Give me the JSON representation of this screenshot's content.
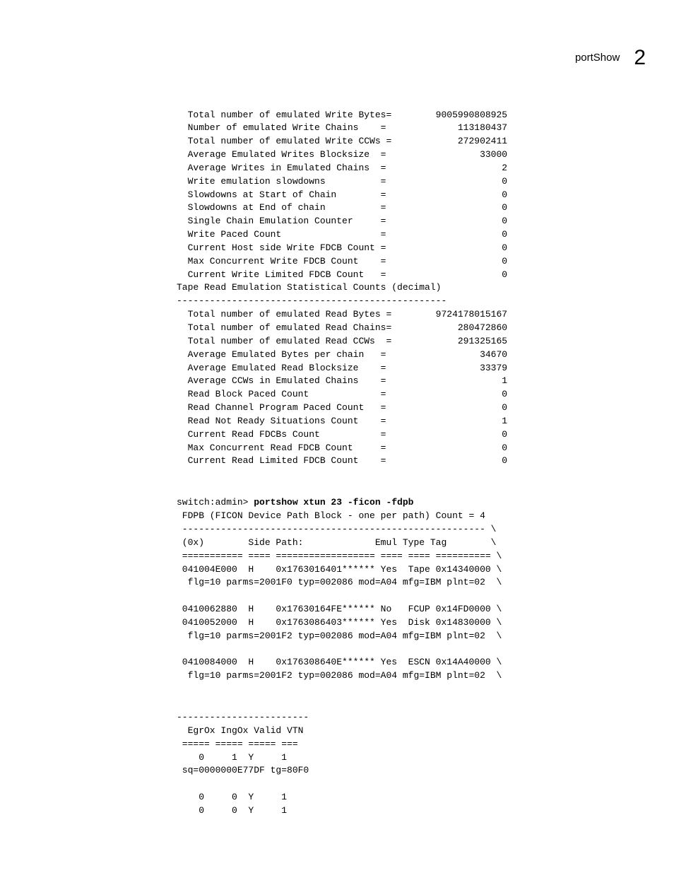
{
  "header": {
    "title": "portShow",
    "chapter": "2"
  },
  "write_stats": [
    {
      "label": "Total number of emulated Write Bytes=",
      "value": "9005990808925"
    },
    {
      "label": "Number of emulated Write Chains    =",
      "value": "113180437"
    },
    {
      "label": "Total number of emulated Write CCWs =",
      "value": "272902411"
    },
    {
      "label": "Average Emulated Writes Blocksize  =",
      "value": "33000"
    },
    {
      "label": "Average Writes in Emulated Chains  =",
      "value": "2"
    },
    {
      "label": "Write emulation slowdowns          =",
      "value": "0"
    },
    {
      "label": "Slowdowns at Start of Chain        =",
      "value": "0"
    },
    {
      "label": "Slowdowns at End of chain          =",
      "value": "0"
    },
    {
      "label": "Single Chain Emulation Counter     =",
      "value": "0"
    },
    {
      "label": "Write Paced Count                  =",
      "value": "0"
    },
    {
      "label": "Current Host side Write FDCB Count =",
      "value": "0"
    },
    {
      "label": "Max Concurrent Write FDCB Count    =",
      "value": "0"
    },
    {
      "label": "Current Write Limited FDCB Count   =",
      "value": "0"
    }
  ],
  "read_section_title": "Tape Read Emulation Statistical Counts (decimal)",
  "read_sep": "-------------------------------------------------",
  "read_stats": [
    {
      "label": "Total number of emulated Read Bytes =",
      "value": "9724178015167"
    },
    {
      "label": "Total number of emulated Read Chains=",
      "value": "280472860"
    },
    {
      "label": "Total number of emulated Read CCWs  =",
      "value": "291325165"
    },
    {
      "label": "Average Emulated Bytes per chain   =",
      "value": "34670"
    },
    {
      "label": "Average Emulated Read Blocksize    =",
      "value": "33379"
    },
    {
      "label": "Average CCWs in Emulated Chains    =",
      "value": "1"
    },
    {
      "label": "Read Block Paced Count             =",
      "value": "0"
    },
    {
      "label": "Read Channel Program Paced Count   =",
      "value": "0"
    },
    {
      "label": "Read Not Ready Situations Count    =",
      "value": "1"
    },
    {
      "label": "Current Read FDCBs Count           =",
      "value": "0"
    },
    {
      "label": "Max Concurrent Read FDCB Count     =",
      "value": "0"
    },
    {
      "label": "Current Read Limited FDCB Count    =",
      "value": "0"
    }
  ],
  "cmd": {
    "prompt": "switch:admin> ",
    "command": "portshow xtun 23 -ficon -fdpb"
  },
  "fdpb": {
    "lines": [
      " FDPB (FICON Device Path Block - one per path) Count = 4",
      " ------------------------------------------------------- \\",
      " (0x)        Side Path:             Emul Type Tag        \\",
      " =========== ==== ================== ==== ==== ========== \\",
      " 041004E000  H    0x1763016401****** Yes  Tape 0x14340000 \\",
      "  flg=10 parms=2001F0 typ=002086 mod=A04 mfg=IBM plnt=02  \\",
      "",
      " 0410062880  H    0x17630164FE****** No   FCUP 0x14FD0000 \\",
      " 0410052000  H    0x1763086403****** Yes  Disk 0x14830000 \\",
      "  flg=10 parms=2001F2 typ=002086 mod=A04 mfg=IBM plnt=02  \\",
      "",
      " 0410084000  H    0x176308640E****** Yes  ESCN 0x14A40000 \\",
      "  flg=10 parms=2001F2 typ=002086 mod=A04 mfg=IBM plnt=02  \\"
    ]
  },
  "tail": {
    "lines": [
      "------------------------",
      "  EgrOx IngOx Valid VTN",
      " ===== ===== ===== ===",
      "    0     1  Y     1",
      " sq=0000000E77DF tg=80F0",
      "",
      "    0     0  Y     1",
      "    0     0  Y     1"
    ]
  }
}
